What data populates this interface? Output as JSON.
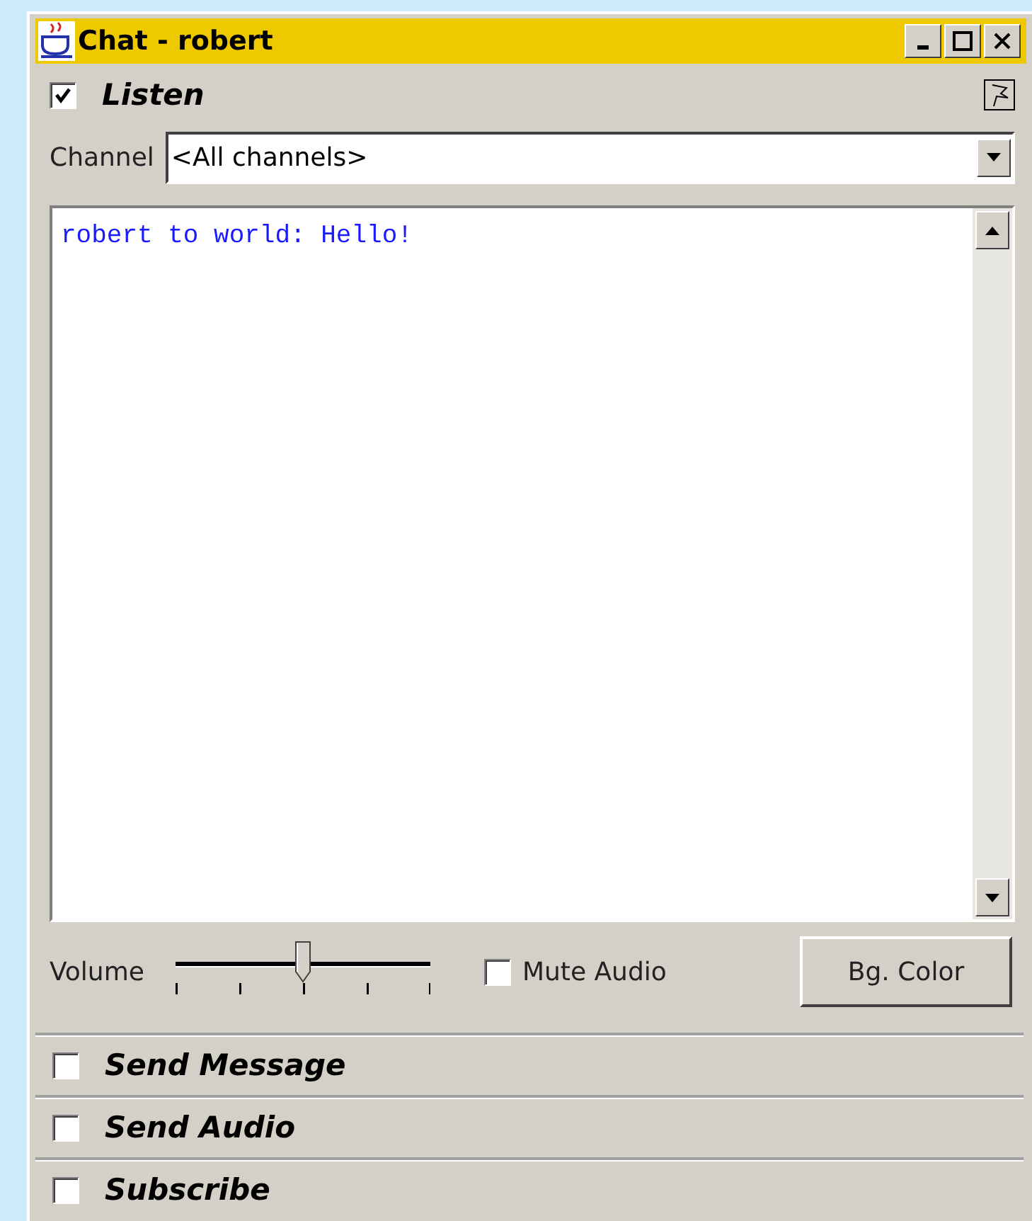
{
  "window": {
    "title": "Chat - robert"
  },
  "listen": {
    "label": "Listen",
    "checked": true
  },
  "channel": {
    "label": "Channel",
    "value": "<All channels>"
  },
  "messages": [
    {
      "text": "robert to world: Hello!"
    }
  ],
  "volume": {
    "label": "Volume",
    "level": 0.5
  },
  "mute": {
    "label": "Mute Audio",
    "checked": false
  },
  "bg_button": "Bg. Color",
  "sections": [
    {
      "label": "Send Message",
      "checked": false
    },
    {
      "label": "Send Audio",
      "checked": false
    },
    {
      "label": "Subscribe",
      "checked": false
    }
  ]
}
